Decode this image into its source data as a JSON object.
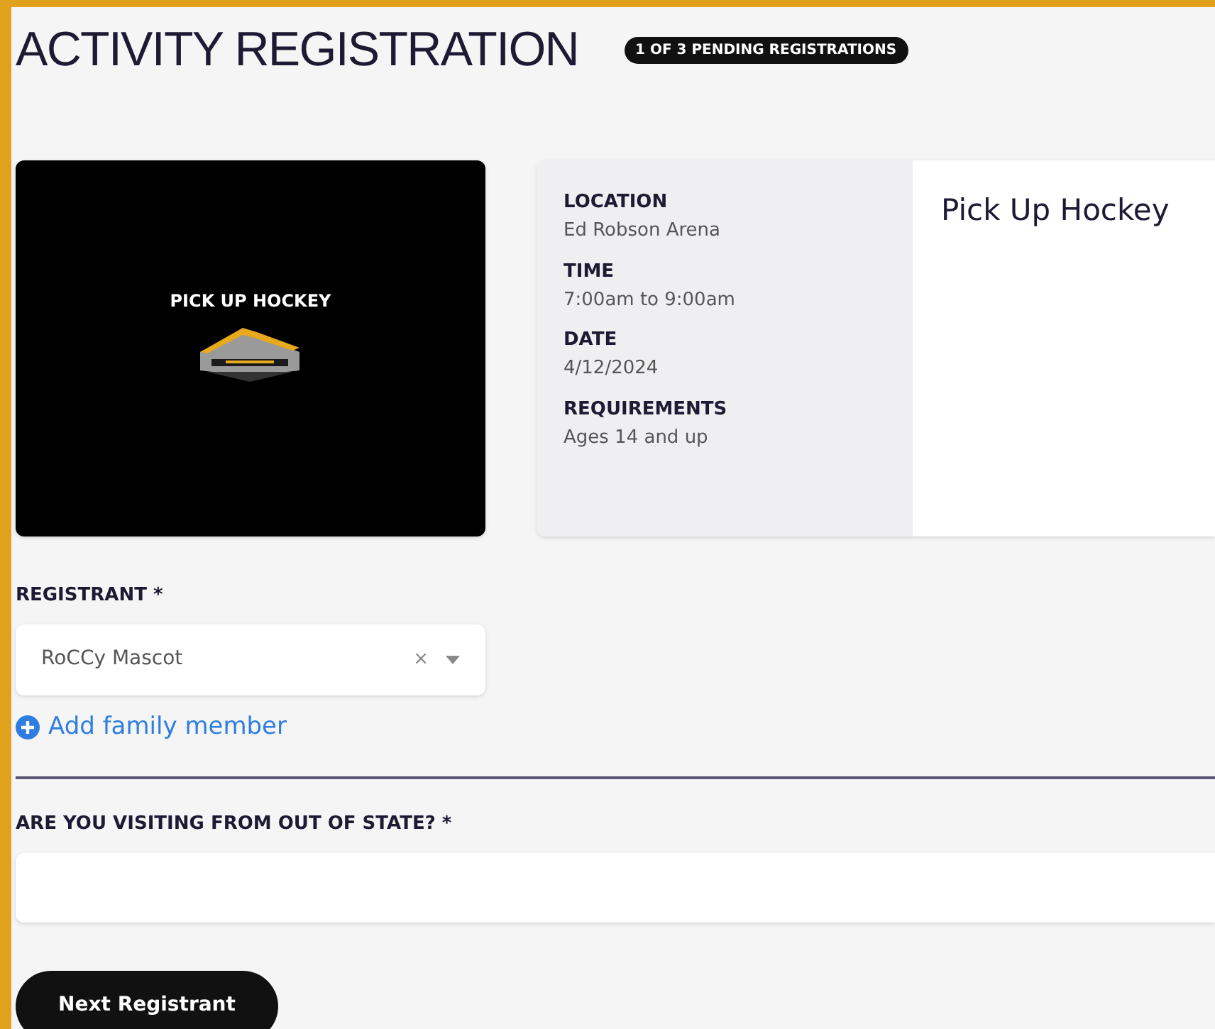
{
  "page": {
    "title": "ACTIVITY REGISTRATION",
    "badge": "1 OF 3 PENDING REGISTRATIONS"
  },
  "activity": {
    "image": {
      "kind": "picture",
      "caption": "PICK UP HOCKEY"
    },
    "details": [
      {
        "label": "LOCATION",
        "value": "Ed Robson Arena"
      },
      {
        "label": "TIME",
        "value": "7:00am to 9:00am"
      },
      {
        "label": "DATE",
        "value": "4/12/2024"
      },
      {
        "label": "REQUIREMENTS",
        "value": "Ages 14 and up"
      }
    ],
    "name": "Pick Up Hockey"
  },
  "registrant": {
    "label": "REGISTRANT *",
    "value": "RoCCy Mascot",
    "clear": "×",
    "add_link": "Add family member"
  },
  "question": {
    "label": "ARE YOU VISITING FROM OUT OF STATE? *"
  },
  "next_button": "Next Registrant"
}
